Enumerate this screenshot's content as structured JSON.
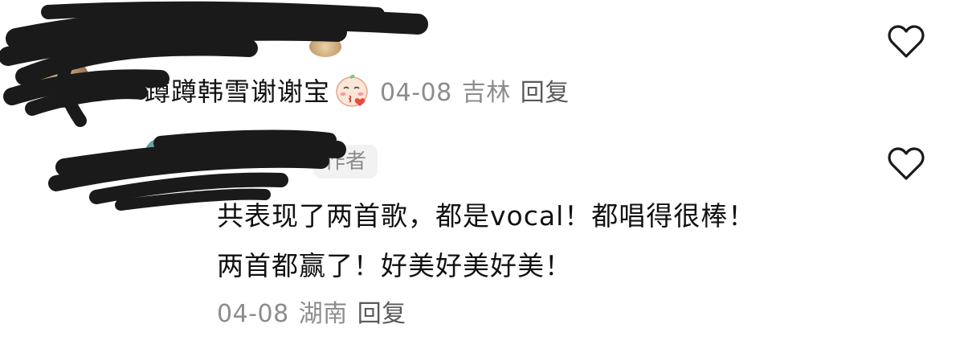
{
  "comments": [
    {
      "text": "蹲蹲韩雪谢谢宝",
      "emoji": "kissing-face-emoji",
      "date": "04-08",
      "location": "吉林",
      "reply_label": "回复",
      "liked": false
    },
    {
      "badge": "作者",
      "lines": [
        "共表现了两首歌，都是vocal！都唱得很棒！",
        "两首都赢了！好美好美好美！"
      ],
      "date": "04-08",
      "location": "湖南",
      "reply_label": "回复",
      "liked": false
    }
  ],
  "icons": {
    "like": "heart-outline-icon"
  },
  "colors": {
    "text": "#111111",
    "meta": "#8c8c8c",
    "reply": "#595959",
    "badge_bg": "#f2f2f2",
    "redaction": "#1a1a1a"
  }
}
